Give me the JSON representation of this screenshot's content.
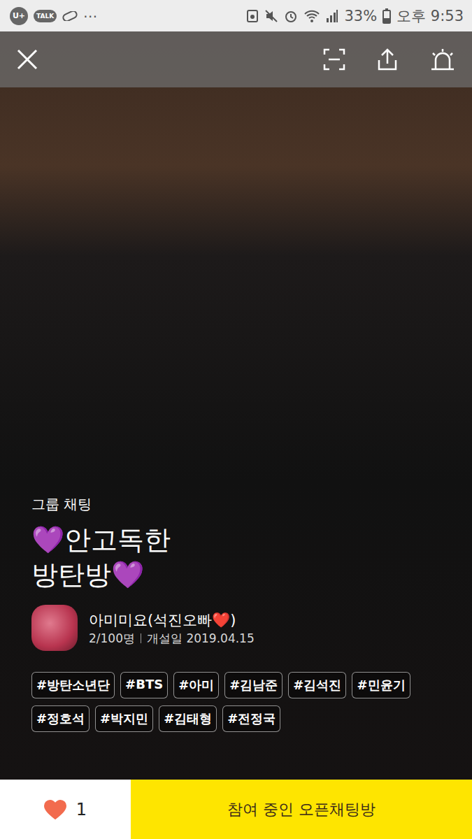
{
  "status_bar": {
    "carrier": "U+",
    "talk_badge": "TALK",
    "more": "⋯",
    "battery": "33%",
    "time": "오후 9:53"
  },
  "room": {
    "type": "그룹 채팅",
    "title_lines": [
      "💜안고독한",
      "방탄방💜"
    ],
    "owner": "아미미요(석진오빠❤️)",
    "members": "2/100명",
    "created": "개설일 2019.04.15",
    "tags": [
      "#방탄소년단",
      "#BTS",
      "#아미",
      "#김남준",
      "#김석진",
      "#민윤기",
      "#정호석",
      "#박지민",
      "#김태형",
      "#전정국"
    ]
  },
  "likes": {
    "count": "1",
    "liked": true
  },
  "join_button": "참여 중인 오픈채팅방"
}
